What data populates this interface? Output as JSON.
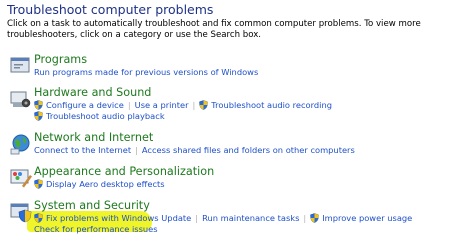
{
  "header": {
    "title": "Troubleshoot computer problems",
    "description": "Click on a task to automatically troubleshoot and fix common computer problems. To view more troubleshooters, click on a category or use the Search box."
  },
  "categories": [
    {
      "title": "Programs",
      "icon": "programs-icon",
      "links": [
        "Run programs made for previous versions of Windows"
      ]
    },
    {
      "title": "Hardware and Sound",
      "icon": "hardware-sound-icon",
      "links": [
        "Configure a device",
        "Use a printer",
        "Troubleshoot audio recording",
        "Troubleshoot audio playback"
      ]
    },
    {
      "title": "Network and Internet",
      "icon": "network-internet-icon",
      "links": [
        "Connect to the Internet",
        "Access shared files and folders on other computers"
      ]
    },
    {
      "title": "Appearance and Personalization",
      "icon": "appearance-personalization-icon",
      "links": [
        "Display Aero desktop effects"
      ]
    },
    {
      "title": "System and Security",
      "icon": "system-security-icon",
      "links": [
        "Fix problems with Windows Update",
        "Run maintenance tasks",
        "Improve power usage",
        "Check for performance issues"
      ]
    }
  ],
  "colors": {
    "title": "#1e3287",
    "category": "#1e7a1e",
    "link": "#1e50c8",
    "highlight": "#f0f52a"
  }
}
